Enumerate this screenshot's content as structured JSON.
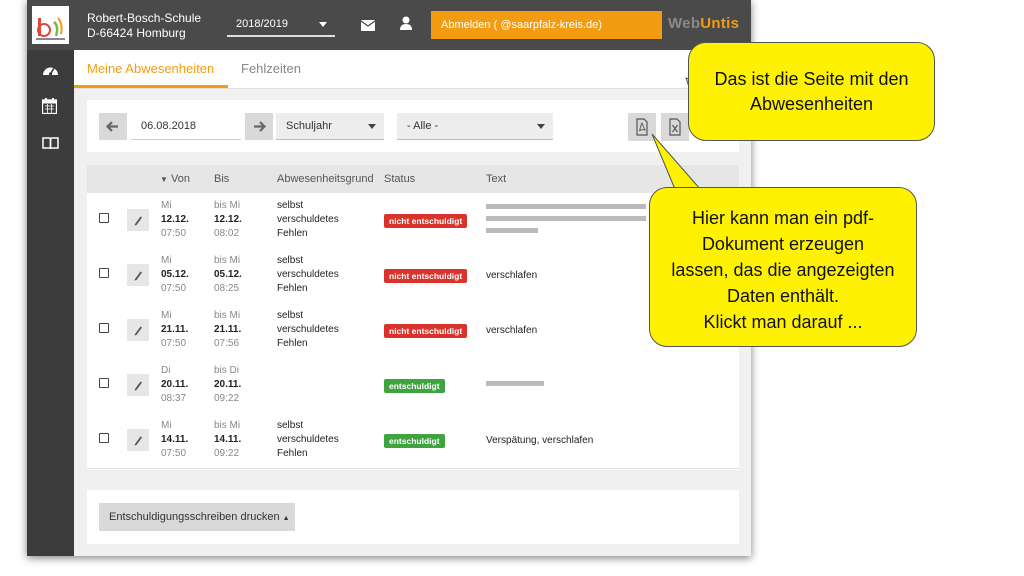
{
  "header": {
    "school_name": "Robert-Bosch-Schule",
    "school_address": "D-66424 Homburg",
    "school_year": "2018/2019",
    "logout_label": "Abmelden (          @saarpfalz-kreis.de)",
    "brand_part1": "Web",
    "brand_part2": "Untis",
    "icons": [
      "mail-icon",
      "user-icon"
    ]
  },
  "sidebar": {
    "icons": [
      "dashboard-icon",
      "calendar-icon",
      "book-icon"
    ]
  },
  "tabs": [
    {
      "label": "Meine Abwesenheiten",
      "active": true
    },
    {
      "label": "Fehlzeiten",
      "active": false
    }
  ],
  "filter": {
    "date": "06.08.2018",
    "period": "Schuljahr",
    "status": "- Alle -"
  },
  "table": {
    "columns": [
      "Von",
      "Bis",
      "Abwesenheitsgrund",
      "Status",
      "Text"
    ],
    "rows": [
      {
        "from_day": "Mi",
        "from_date": "12.12.",
        "from_time": "07:50",
        "to_day": "bis Mi",
        "to_date": "12.12.",
        "to_time": "08:02",
        "reason": [
          "selbst",
          "verschuldetes",
          "Fehlen"
        ],
        "status": "nicht entschuldigt",
        "status_type": "red",
        "text": ""
      },
      {
        "from_day": "Mi",
        "from_date": "05.12.",
        "from_time": "07:50",
        "to_day": "bis Mi",
        "to_date": "05.12.",
        "to_time": "08:25",
        "reason": [
          "selbst",
          "verschuldetes",
          "Fehlen"
        ],
        "status": "nicht entschuldigt",
        "status_type": "red",
        "text": "verschlafen"
      },
      {
        "from_day": "Mi",
        "from_date": "21.11.",
        "from_time": "07:50",
        "to_day": "bis Mi",
        "to_date": "21.11.",
        "to_time": "07:56",
        "reason": [
          "selbst",
          "verschuldetes",
          "Fehlen"
        ],
        "status": "nicht entschuldigt",
        "status_type": "red",
        "text": "verschlafen"
      },
      {
        "from_day": "Di",
        "from_date": "20.11.",
        "from_time": "08:37",
        "to_day": "bis Di",
        "to_date": "20.11.",
        "to_time": "09:22",
        "reason": [
          "",
          "",
          ""
        ],
        "status": "entschuldigt",
        "status_type": "green",
        "text": ""
      },
      {
        "from_day": "Mi",
        "from_date": "14.11.",
        "from_time": "07:50",
        "to_day": "bis Mi",
        "to_date": "14.11.",
        "to_time": "09:22",
        "reason": [
          "selbst",
          "verschuldetes",
          "Fehlen"
        ],
        "status": "entschuldigt",
        "status_type": "green",
        "text": "Verspätung, verschlafen"
      }
    ]
  },
  "bottom": {
    "print_label": "Entschuldigungsschreiben drucken"
  },
  "callouts": {
    "callout1": [
      "Das ist die Seite mit den",
      "Abwesenheiten"
    ],
    "callout2": [
      "Hier kann man ein pdf-",
      "Dokument erzeugen",
      "lassen, das die angezeigten",
      "Daten enthält.",
      "Klickt man darauf ..."
    ]
  },
  "colors": {
    "accent": "#f39c12",
    "topbar": "#4a4a4a",
    "sidebar": "#3c3c3c",
    "badge_red": "#d9332b",
    "badge_green": "#3fa33f",
    "callout": "#fff200"
  }
}
